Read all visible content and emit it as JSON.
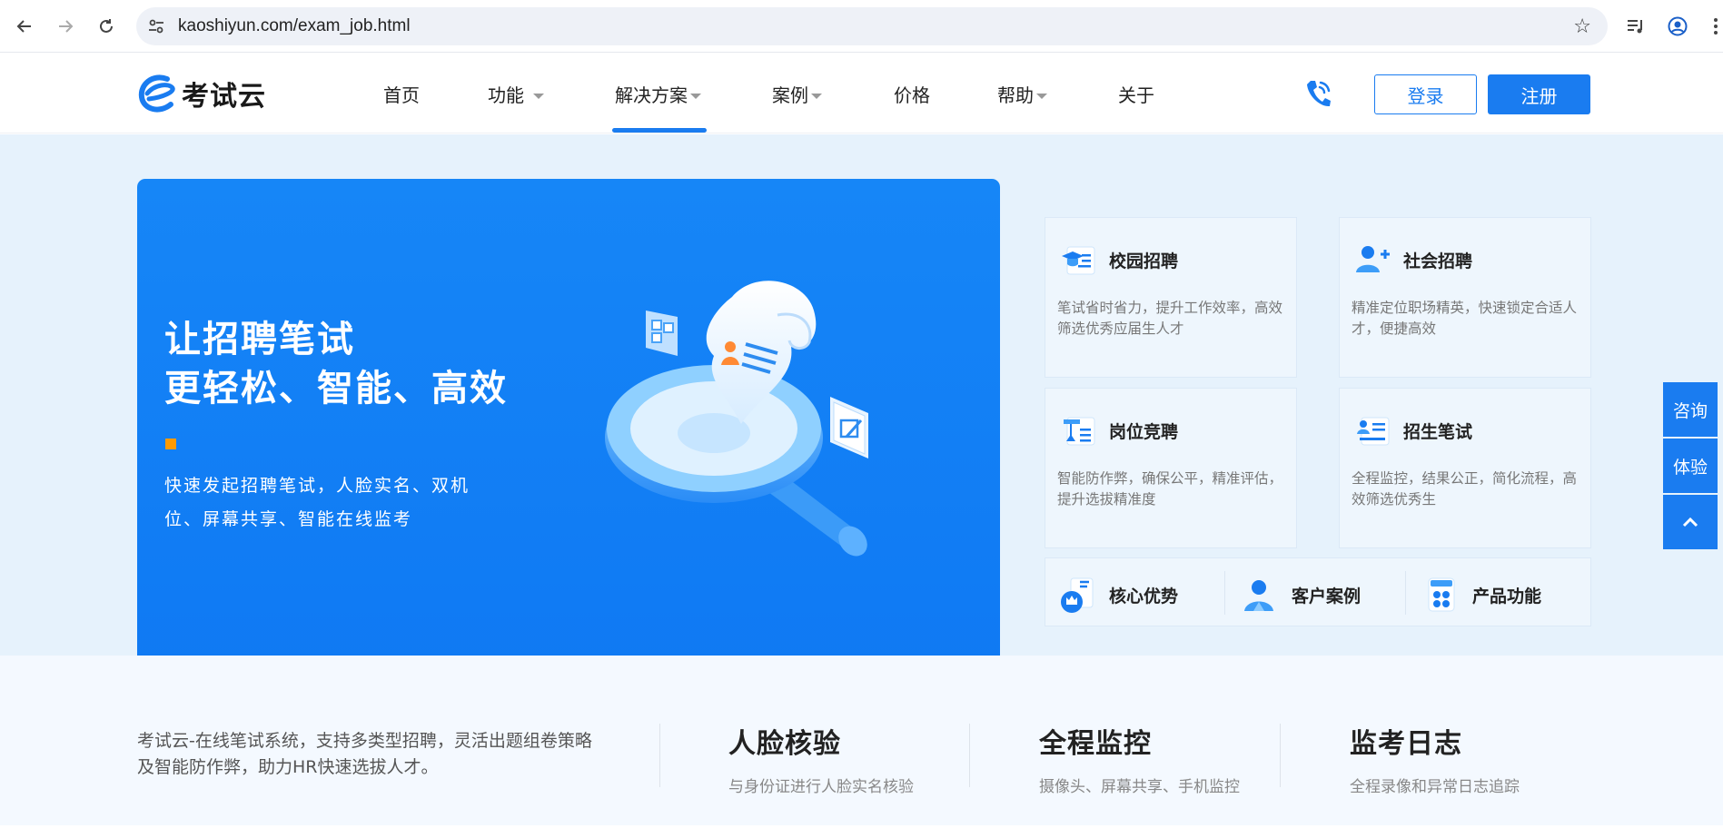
{
  "browser": {
    "url": "kaoshiyun.com/exam_job.html"
  },
  "header": {
    "logo_text": "考试云",
    "menu": [
      {
        "label": "首页"
      },
      {
        "label": "功能"
      },
      {
        "label": "解决方案"
      },
      {
        "label": "案例"
      },
      {
        "label": "价格"
      },
      {
        "label": "帮助"
      },
      {
        "label": "关于"
      }
    ],
    "login_label": "登录",
    "register_label": "注册"
  },
  "hero": {
    "title_line1": "让招聘笔试",
    "title_line2": "更轻松、智能、高效",
    "desc_line1": "快速发起招聘笔试，人脸实名、双机",
    "desc_line2": "位、屏幕共享、智能在线监考"
  },
  "features": [
    {
      "title": "校园招聘",
      "desc": "笔试省时省力，提升工作效率，高效筛选优秀应届生人才"
    },
    {
      "title": "社会招聘",
      "desc": "精准定位职场精英，快速锁定合适人才，便捷高效"
    },
    {
      "title": "岗位竞聘",
      "desc": "智能防作弊，确保公平，精准评估，提升选拔精准度"
    },
    {
      "title": "招生笔试",
      "desc": "全程监控，结果公正，简化流程，高效筛选优秀生"
    }
  ],
  "advantages": [
    {
      "label": "核心优势"
    },
    {
      "label": "客户案例"
    },
    {
      "label": "产品功能"
    }
  ],
  "float_tabs": {
    "consult": "咨询",
    "trial": "体验"
  },
  "bottom": {
    "intro_line1": "考试云-在线笔试系统，支持多类型招聘，灵活出题组卷策略",
    "intro_line2": "及智能防作弊，助力HR快速选拔人才。",
    "stats": [
      {
        "title": "人脸核验",
        "desc": "与身份证进行人脸实名核验"
      },
      {
        "title": "全程监控",
        "desc": "摄像头、屏幕共享、手机监控"
      },
      {
        "title": "监考日志",
        "desc": "全程录像和异常日志追踪"
      }
    ]
  },
  "colors": {
    "brand": "#1a7cf0",
    "hero_bg": "#e6f2fc",
    "accent_orange": "#ff9a00"
  },
  "icons": {
    "back": "arrow-left-icon",
    "forward": "arrow-right-icon",
    "reload": "reload-icon",
    "site_info": "tune-icon",
    "bookmark": "star-icon",
    "phone": "phone-icon",
    "scroll_top": "chevron-up-icon"
  }
}
